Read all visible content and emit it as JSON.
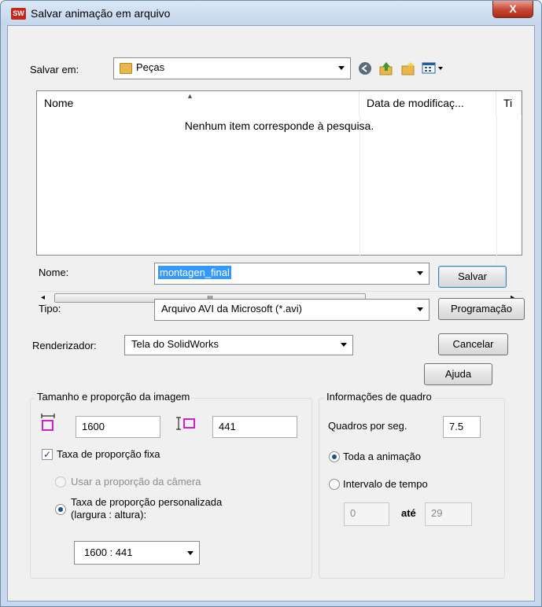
{
  "window": {
    "title": "Salvar animação em arquivo",
    "app_icon_text": "SW",
    "close_glyph": "X"
  },
  "topbar": {
    "save_in_label": "Salvar em:",
    "save_in_value": "Peças",
    "icons": [
      "back-icon",
      "up-folder-icon",
      "new-folder-icon",
      "view-menu-icon"
    ]
  },
  "filelist": {
    "columns": [
      "Nome",
      "Data de modificaç...",
      "Ti"
    ],
    "empty_message": "Nenhum item corresponde à pesquisa.",
    "scroll_grip": "III"
  },
  "fields": {
    "name_label": "Nome:",
    "name_value": "montagen_final",
    "type_label": "Tipo:",
    "type_value": "Arquivo AVI da Microsoft (*.avi)",
    "renderer_label": "Renderizador:",
    "renderer_value": "Tela do SolidWorks"
  },
  "buttons": {
    "save": "Salvar",
    "schedule": "Programação",
    "cancel": "Cancelar",
    "help": "Ajuda"
  },
  "image_size": {
    "title": "Tamanho e proporção da imagem",
    "width": "1600",
    "height": "441",
    "fixed_ratio_label": "Taxa de proporção fixa",
    "fixed_ratio_checked": true,
    "camera_ratio_label": "Usar a proporção da câmera",
    "custom_ratio_label": "Taxa de proporção personalizada",
    "custom_ratio_sublabel": "(largura : altura):",
    "ratio_value": "1600 : 441"
  },
  "frame_info": {
    "title": "Informações de quadro",
    "fps_label": "Quadros por seg.",
    "fps_value": "7.5",
    "whole_anim_label": "Toda a animação",
    "time_range_label": "Intervalo de tempo",
    "range_from": "0",
    "range_to_label": "até",
    "range_to": "29"
  },
  "colors": {
    "title_bar": "#c3d6ec",
    "close_button": "#c64632",
    "selection": "#3399ff",
    "folder": "#e8b64a"
  }
}
